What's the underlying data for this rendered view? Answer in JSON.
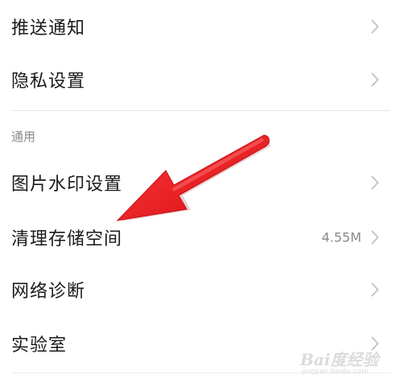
{
  "settings": {
    "top_items": [
      {
        "label": "推送通知"
      },
      {
        "label": "隐私设置"
      }
    ],
    "general_section": {
      "header": "通用",
      "items": [
        {
          "label": "图片水印设置",
          "value": ""
        },
        {
          "label": "清理存储空间",
          "value": "4.55M"
        },
        {
          "label": "网络诊断",
          "value": ""
        },
        {
          "label": "实验室",
          "value": ""
        }
      ]
    }
  },
  "annotation": {
    "arrow_color": "#e8141b",
    "arrow_target": "清理存储空间"
  },
  "watermark": {
    "logo": "Bai度经验",
    "url": "jingyan.baidu.com"
  },
  "colors": {
    "text": "#1a1a1a",
    "secondary_text": "#8a8a8a",
    "divider": "#e6e6e6",
    "chevron": "#c4c4c4",
    "background": "#ffffff"
  }
}
